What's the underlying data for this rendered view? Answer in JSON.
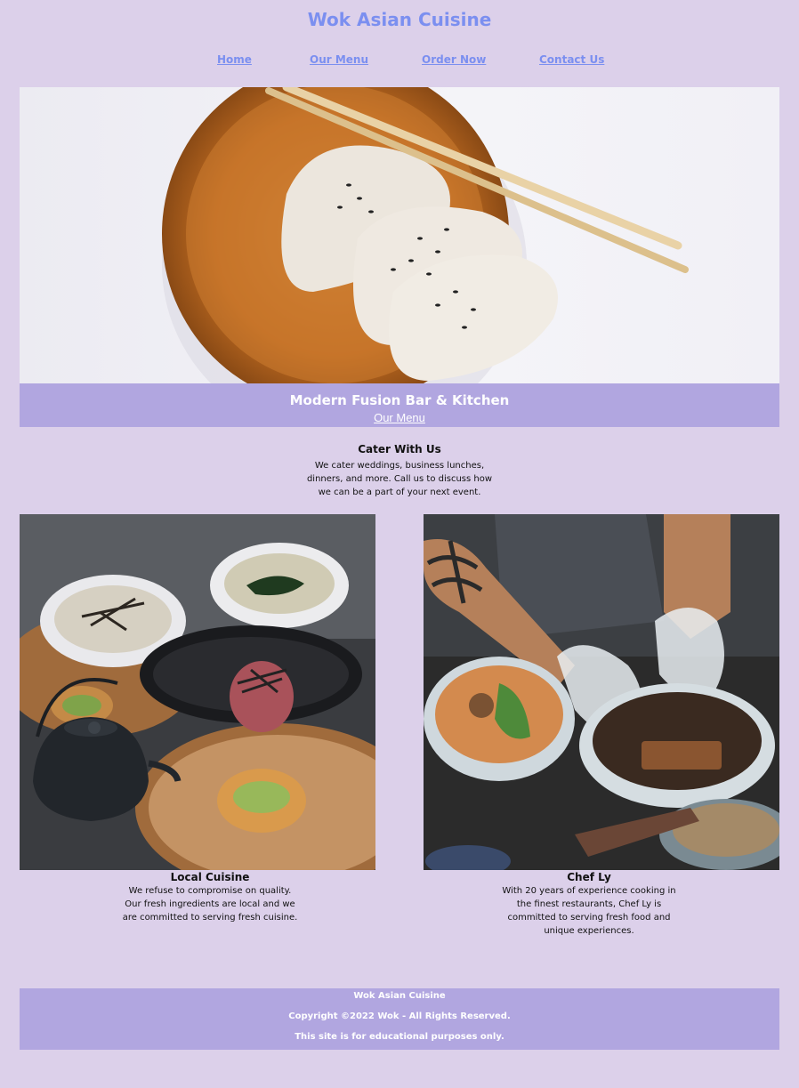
{
  "site": {
    "title": "Wok Asian Cuisine"
  },
  "nav": {
    "items": [
      {
        "label": "Home"
      },
      {
        "label": "Our Menu"
      },
      {
        "label": "Order Now"
      },
      {
        "label": "Contact Us"
      }
    ]
  },
  "hero": {
    "tagline": "Modern Fusion Bar & Kitchen",
    "link_label": "Our Menu"
  },
  "cater": {
    "title": "Cater With Us",
    "body": "We cater weddings, business lunches, dinners, and more. Call us to discuss how we can be a part of your next event."
  },
  "cards": [
    {
      "title": "Local Cuisine",
      "body": "We refuse to compromise on quality. Our fresh ingredients are local and we are committed to serving fresh cuisine."
    },
    {
      "title": "Chef Ly",
      "body": "With 20 years of experience cooking in the finest restaurants, Chef Ly is committed to serving fresh food and unique experiences."
    }
  ],
  "footer": {
    "name": "Wok Asian Cuisine",
    "copyright": "Copyright ©2022 Wok - All Rights Reserved.",
    "disclaimer": "This site is for educational purposes only."
  },
  "colors": {
    "background": "#dcd0ea",
    "accent": "#7b8ff0",
    "banner": "#b1a6e0"
  }
}
